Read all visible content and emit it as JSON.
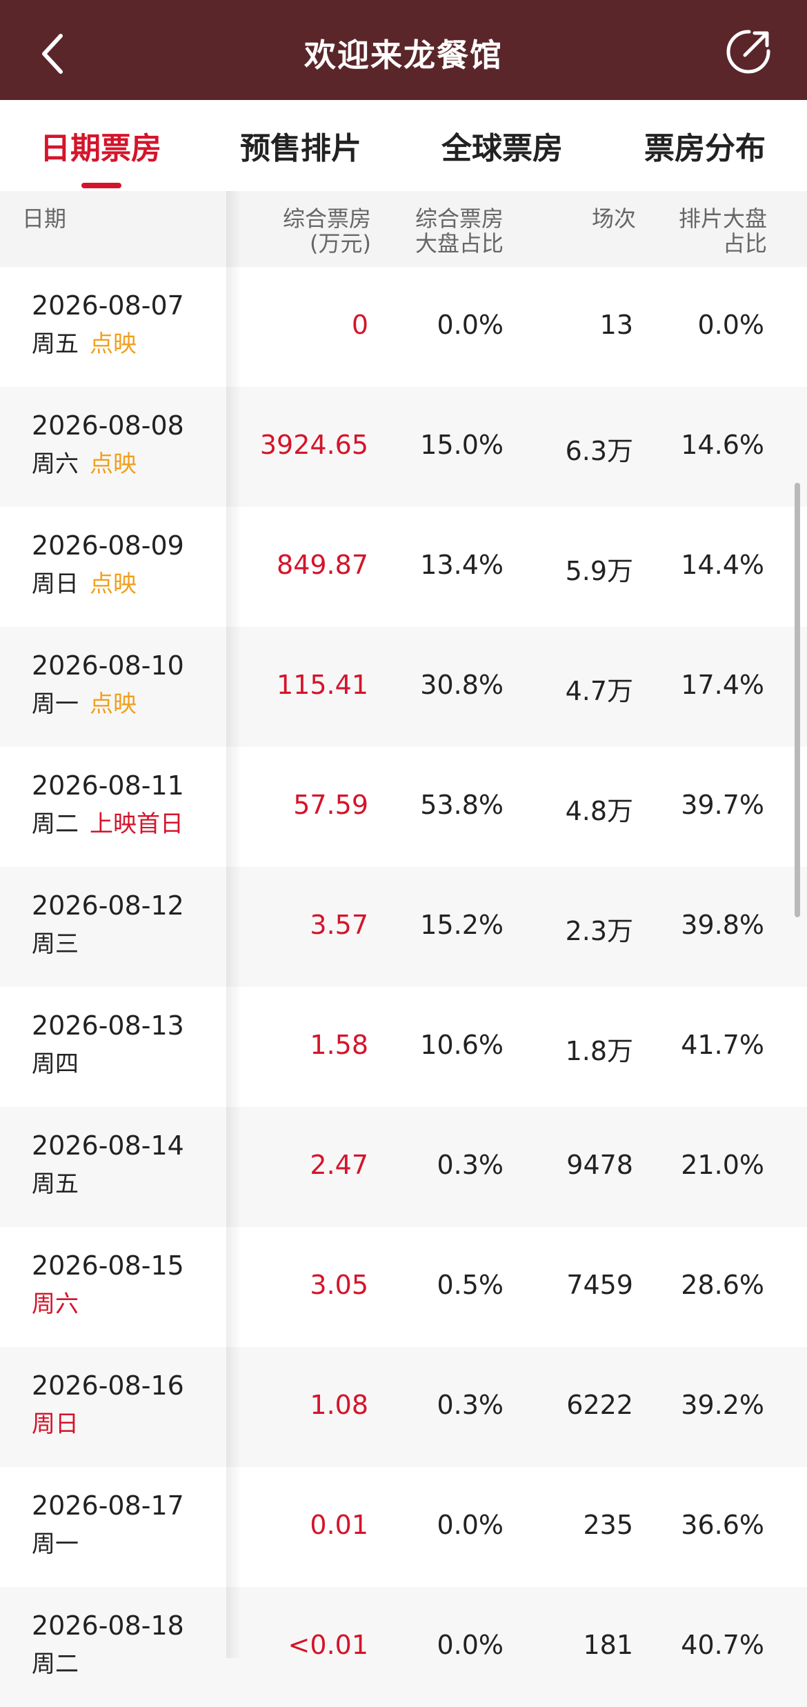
{
  "header": {
    "title": "欢迎来龙餐馆",
    "back_icon": "chevron-left-icon",
    "share_icon": "share-icon",
    "color": "#5a262a"
  },
  "tabs": [
    {
      "label": "日期票房",
      "active": true
    },
    {
      "label": "预售排片",
      "active": false
    },
    {
      "label": "全球票房",
      "active": false
    },
    {
      "label": "票房分布",
      "active": false
    }
  ],
  "accent_color": "#d4142b",
  "table": {
    "columns": {
      "date": "日期",
      "box_line1": "综合票房",
      "box_line2": "(万元)",
      "share_line1": "综合票房",
      "share_line2": "大盘占比",
      "shows": "场次",
      "sched_line1": "排片大盘",
      "sched_line2": "占比"
    },
    "rows": [
      {
        "date": "2026-08-07",
        "weekday": "周五",
        "weekday_red": false,
        "tag": "点映",
        "tag_color": "orange",
        "box": "0",
        "share": "0.0%",
        "shows": "13",
        "sched": "0.0%"
      },
      {
        "date": "2026-08-08",
        "weekday": "周六",
        "weekday_red": false,
        "tag": "点映",
        "tag_color": "orange",
        "box": "3924.65",
        "share": "15.0%",
        "shows": "6.3万",
        "sched": "14.6%"
      },
      {
        "date": "2026-08-09",
        "weekday": "周日",
        "weekday_red": false,
        "tag": "点映",
        "tag_color": "orange",
        "box": "849.87",
        "share": "13.4%",
        "shows": "5.9万",
        "sched": "14.4%"
      },
      {
        "date": "2026-08-10",
        "weekday": "周一",
        "weekday_red": false,
        "tag": "点映",
        "tag_color": "orange",
        "box": "115.41",
        "share": "30.8%",
        "shows": "4.7万",
        "sched": "17.4%"
      },
      {
        "date": "2026-08-11",
        "weekday": "周二",
        "weekday_red": false,
        "tag": "上映首日",
        "tag_color": "red",
        "box": "57.59",
        "share": "53.8%",
        "shows": "4.8万",
        "sched": "39.7%"
      },
      {
        "date": "2026-08-12",
        "weekday": "周三",
        "weekday_red": false,
        "tag": "",
        "tag_color": "",
        "box": "3.57",
        "share": "15.2%",
        "shows": "2.3万",
        "sched": "39.8%"
      },
      {
        "date": "2026-08-13",
        "weekday": "周四",
        "weekday_red": false,
        "tag": "",
        "tag_color": "",
        "box": "1.58",
        "share": "10.6%",
        "shows": "1.8万",
        "sched": "41.7%"
      },
      {
        "date": "2026-08-14",
        "weekday": "周五",
        "weekday_red": false,
        "tag": "",
        "tag_color": "",
        "box": "2.47",
        "share": "0.3%",
        "shows": "9478",
        "sched": "21.0%"
      },
      {
        "date": "2026-08-15",
        "weekday": "周六",
        "weekday_red": true,
        "tag": "",
        "tag_color": "",
        "box": "3.05",
        "share": "0.5%",
        "shows": "7459",
        "sched": "28.6%"
      },
      {
        "date": "2026-08-16",
        "weekday": "周日",
        "weekday_red": true,
        "tag": "",
        "tag_color": "",
        "box": "1.08",
        "share": "0.3%",
        "shows": "6222",
        "sched": "39.2%"
      },
      {
        "date": "2026-08-17",
        "weekday": "周一",
        "weekday_red": false,
        "tag": "",
        "tag_color": "",
        "box": "0.01",
        "share": "0.0%",
        "shows": "235",
        "sched": "36.6%"
      },
      {
        "date": "2026-08-18",
        "weekday": "周二",
        "weekday_red": false,
        "tag": "",
        "tag_color": "",
        "box": "<0.01",
        "share": "0.0%",
        "shows": "181",
        "sched": "40.7%"
      }
    ]
  }
}
